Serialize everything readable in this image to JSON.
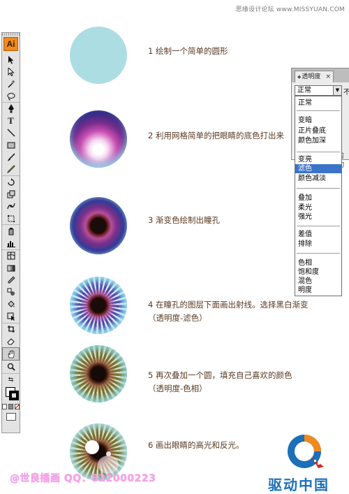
{
  "watermark": "思缘设计论坛 www.MISSYUAN.COM",
  "toolbar": {
    "logo": "Ai",
    "tools": [
      "selection-icon",
      "direct-selection-icon",
      "magic-wand-icon",
      "lasso-icon",
      "pen-icon",
      "type-icon",
      "line-icon",
      "rectangle-icon",
      "paintbrush-icon",
      "pencil-icon",
      "rotate-icon",
      "scale-icon",
      "warp-icon",
      "free-transform-icon",
      "symbol-sprayer-icon",
      "column-graph-icon",
      "mesh-icon",
      "gradient-icon",
      "eyedropper-icon",
      "blend-icon",
      "live-paint-bucket-icon",
      "live-paint-selection-icon",
      "slice-icon",
      "eraser-icon",
      "hand-icon",
      "zoom-icon"
    ]
  },
  "steps": [
    {
      "id": 1,
      "lines": [
        "1 绘制一个简单的圆形"
      ]
    },
    {
      "id": 2,
      "lines": [
        "2 利用网格简单的把眼睛的底色打出来"
      ]
    },
    {
      "id": 3,
      "lines": [
        "3 渐变色绘制出瞳孔"
      ]
    },
    {
      "id": 4,
      "lines": [
        "4 在瞳孔的图层下面画出射线。选择黑白渐变",
        "（透明度-滤色）"
      ]
    },
    {
      "id": 5,
      "lines": [
        "5 再次叠加一个圆，填充自己喜欢的颜色",
        "（透明度-色相）"
      ]
    },
    {
      "id": 6,
      "lines": [
        "6 画出眼睛的高光和反光。"
      ]
    }
  ],
  "transparency_panel": {
    "tab_title": "透明度",
    "close": "×",
    "mode_selected": "正常",
    "opacity_label_fragment": "不",
    "side_label_fragment": "剪切"
  },
  "blend_modes": [
    {
      "label": "正常",
      "selected": false
    },
    {
      "label": "变暗",
      "selected": false
    },
    {
      "label": "正片叠底",
      "selected": false
    },
    {
      "label": "颜色加深",
      "selected": false
    },
    {
      "label": "变亮",
      "selected": false
    },
    {
      "label": "滤色",
      "selected": true
    },
    {
      "label": "颜色减淡",
      "selected": false
    },
    {
      "label": "叠加",
      "selected": false
    },
    {
      "label": "柔光",
      "selected": false
    },
    {
      "label": "强光",
      "selected": false
    },
    {
      "label": "差值",
      "selected": false
    },
    {
      "label": "排除",
      "selected": false
    },
    {
      "label": "色相",
      "selected": false
    },
    {
      "label": "饱和度",
      "selected": false
    },
    {
      "label": "混色",
      "selected": false
    },
    {
      "label": "明度",
      "selected": false
    }
  ],
  "footer": {
    "qq": "@世良插画 QQ：822000223",
    "brand": "驱动中国",
    "brand_color": "#1c6fb8",
    "accent_pink": "#f6a3e8"
  }
}
